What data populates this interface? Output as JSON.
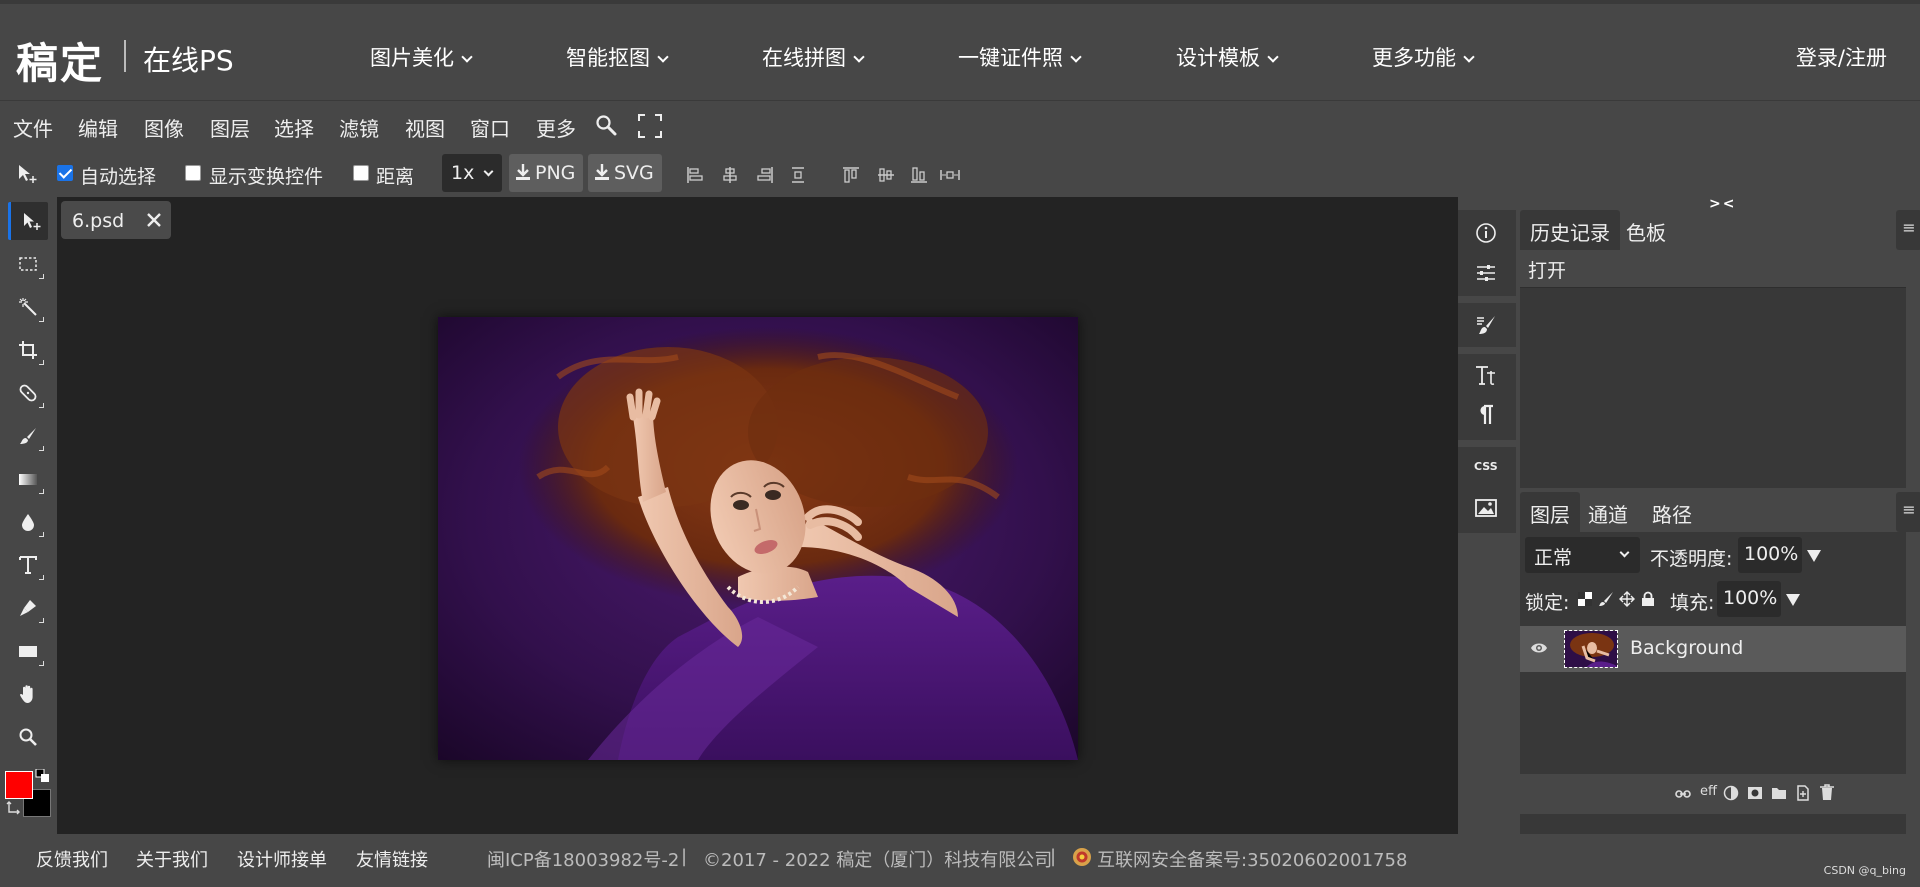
{
  "nav": {
    "logo": "稿定",
    "logo_sub": "在线PS",
    "items": [
      "图片美化",
      "智能抠图",
      "在线拼图",
      "一键证件照",
      "设计模板",
      "更多功能"
    ],
    "login": "登录/注册"
  },
  "menubar": {
    "items": [
      "文件",
      "编辑",
      "图像",
      "图层",
      "选择",
      "滤镜",
      "视图",
      "窗口",
      "更多"
    ]
  },
  "options": {
    "auto_select": "自动选择",
    "auto_select_checked": true,
    "show_transform": "显示变换控件",
    "show_transform_checked": false,
    "distance": "距离",
    "distance_checked": false,
    "zoom": "1x",
    "export_png": "PNG",
    "export_svg": "SVG"
  },
  "document": {
    "tab_name": "6.psd"
  },
  "colors": {
    "foreground": "#ff0000",
    "background": "#000000",
    "accent": "#1a73e8"
  },
  "panels": {
    "collapse_left": "<>",
    "collapse_right": "><",
    "history_tabs": [
      "历史记录",
      "色板"
    ],
    "history_items": [
      "打开"
    ],
    "layer_tabs": [
      "图层",
      "通道",
      "路径"
    ],
    "blend_mode": "正常",
    "opacity_label": "不透明度:",
    "opacity": "100%",
    "lock_label": "锁定:",
    "fill_label": "填充:",
    "fill": "100%",
    "layers": [
      {
        "name": "Background",
        "visible": true
      }
    ],
    "menu_glyph": "≡",
    "css_label": "CSS",
    "eff_label": "eff"
  },
  "footer": {
    "links": [
      "反馈我们",
      "关于我们",
      "设计师接单",
      "友情链接"
    ],
    "icp": "闽ICP备18003982号-2",
    "copyright": "©2017 - 2022 稿定（厦门）科技有限公司",
    "police": "互联网安全备案号:35020602001758",
    "watermark": "CSDN @q_bing"
  }
}
